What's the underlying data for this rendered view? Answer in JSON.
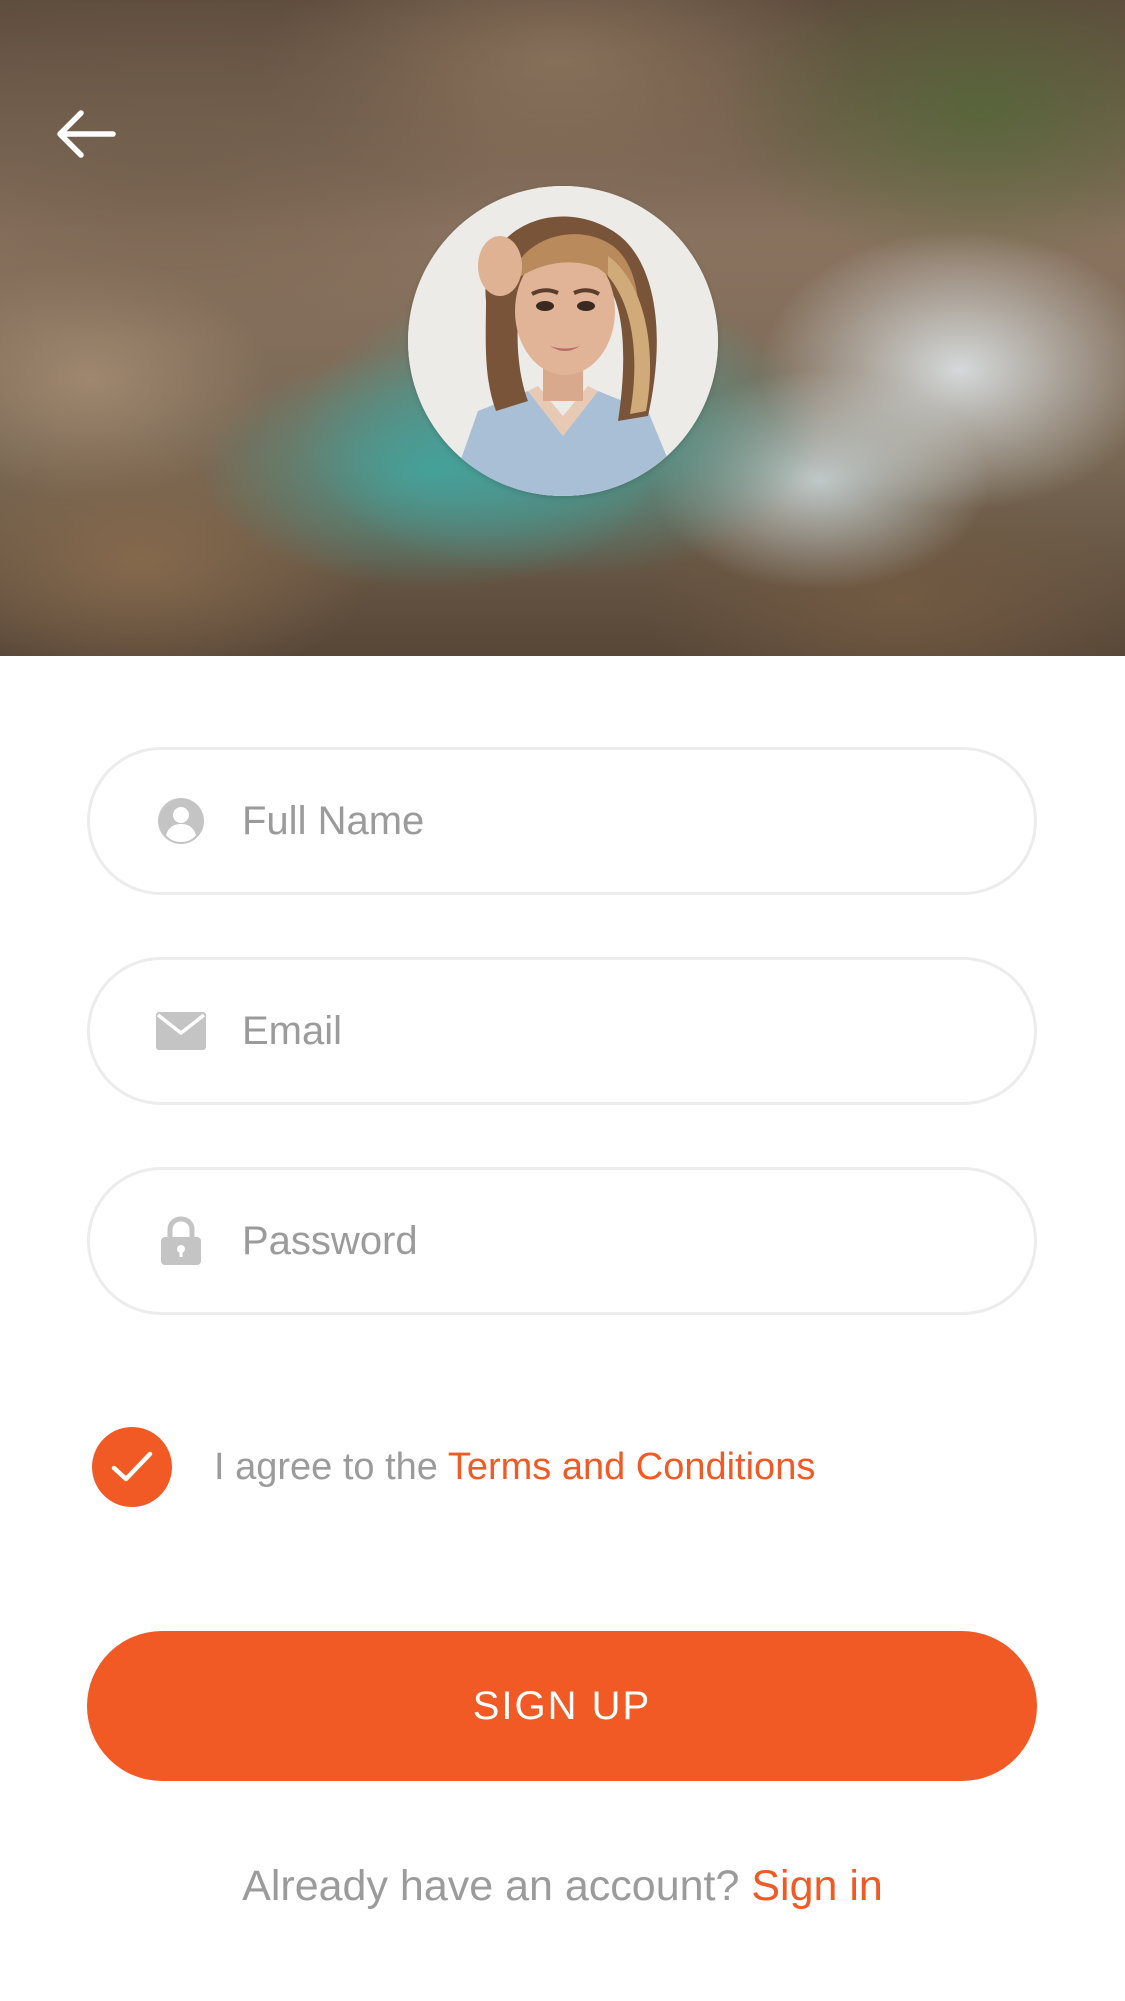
{
  "header": {
    "back_icon": "arrow-left-icon",
    "avatar_alt": "profile-photo"
  },
  "form": {
    "full_name": {
      "placeholder": "Full Name",
      "value": "",
      "icon": "user-icon"
    },
    "email": {
      "placeholder": "Email",
      "value": "",
      "icon": "envelope-icon"
    },
    "password": {
      "placeholder": "Password",
      "value": "",
      "icon": "lock-icon"
    }
  },
  "terms": {
    "checked": true,
    "prefix": "I agree to the ",
    "link_label": "Terms and Conditions"
  },
  "signup_button": {
    "label": "SIGN UP"
  },
  "footer": {
    "prompt": "Already have an account? ",
    "link_label": "Sign in"
  },
  "colors": {
    "accent": "#f15a24",
    "muted_text": "#9b9b9b",
    "field_border": "#ececec",
    "icon_gray": "#c4c4c4"
  }
}
